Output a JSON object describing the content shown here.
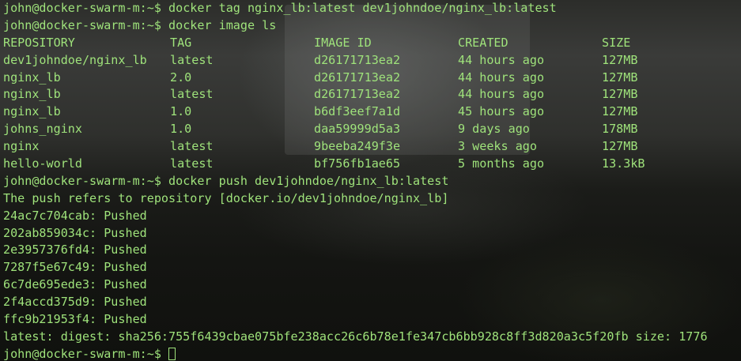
{
  "terminal": {
    "text_color": "#9fe37b",
    "prompt": "john@docker-swarm-m:~$",
    "commands": {
      "tag": "docker tag nginx_lb:latest dev1johndoe/nginx_lb:latest",
      "image_ls": "docker image ls",
      "push": "docker push dev1johndoe/nginx_lb:latest"
    },
    "image_table": {
      "headers": [
        "REPOSITORY",
        "TAG",
        "IMAGE ID",
        "CREATED",
        "SIZE"
      ],
      "rows": [
        [
          "dev1johndoe/nginx_lb",
          "latest",
          "d26171713ea2",
          "44 hours ago",
          "127MB"
        ],
        [
          "nginx_lb",
          "2.0",
          "d26171713ea2",
          "44 hours ago",
          "127MB"
        ],
        [
          "nginx_lb",
          "latest",
          "d26171713ea2",
          "44 hours ago",
          "127MB"
        ],
        [
          "nginx_lb",
          "1.0",
          "b6df3eef7a1d",
          "45 hours ago",
          "127MB"
        ],
        [
          "johns_nginx",
          "1.0",
          "daa59999d5a3",
          "9 days ago",
          "178MB"
        ],
        [
          "nginx",
          "latest",
          "9beeba249f3e",
          "3 weeks ago",
          "127MB"
        ],
        [
          "hello-world",
          "latest",
          "bf756fb1ae65",
          "5 months ago",
          "13.3kB"
        ]
      ]
    },
    "push_output": {
      "refers": "The push refers to repository [docker.io/dev1johndoe/nginx_lb]",
      "layers": [
        "24ac7c704cab: Pushed",
        "202ab859034c: Pushed",
        "2e3957376fd4: Pushed",
        "7287f5e67c49: Pushed",
        "6c7de695ede3: Pushed",
        "2f4accd375d9: Pushed",
        "ffc9b21953f4: Pushed"
      ],
      "digest": "latest: digest: sha256:755f6439cbae075bfe238acc26c6b78e1fe347cb6bb928c8ff3d820a3c5f20fb size: 1776"
    }
  }
}
